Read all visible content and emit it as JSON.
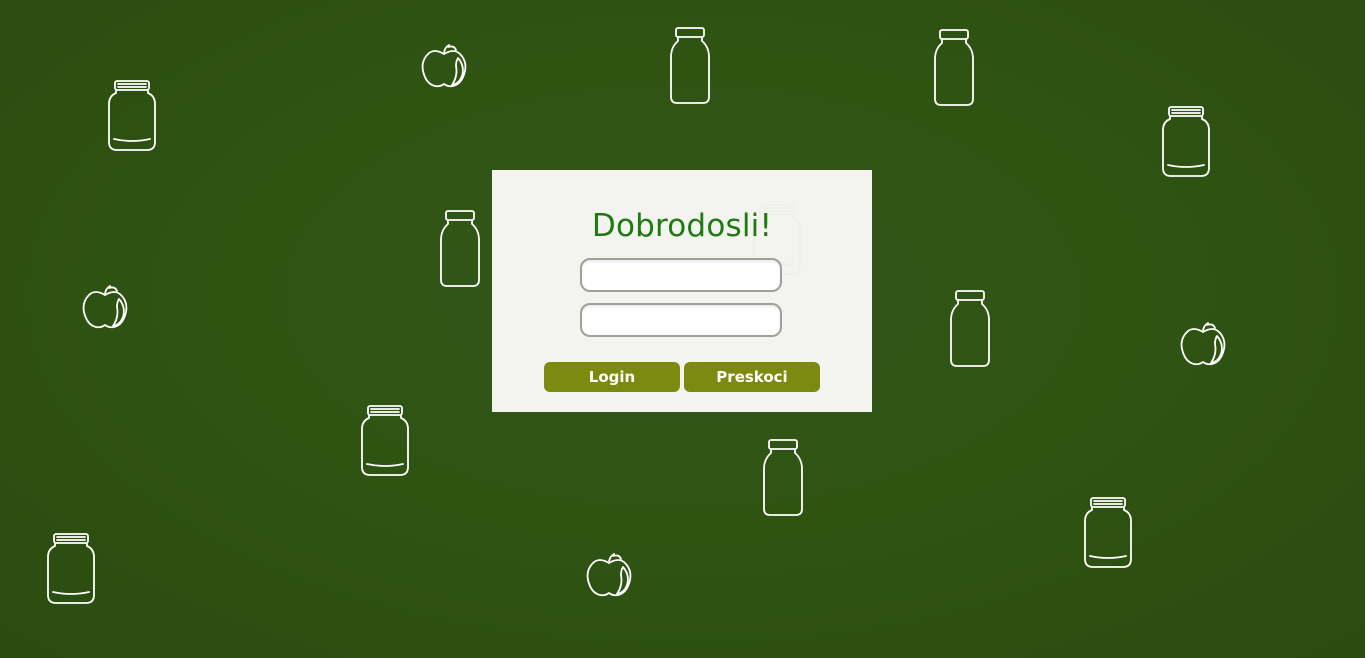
{
  "login_panel": {
    "title": "Dobrodosli!",
    "username": {
      "value": "",
      "placeholder": ""
    },
    "password": {
      "value": "",
      "placeholder": ""
    },
    "login_label": "Login",
    "skip_label": "Preskoci"
  },
  "background": {
    "color": "#2e5211",
    "decorations": [
      "jar-icon",
      "bottle-icon",
      "apple-icon"
    ]
  },
  "colors": {
    "title": "#1f7a12",
    "button": "#7e8a0f",
    "panel": "#f3f4ef"
  }
}
